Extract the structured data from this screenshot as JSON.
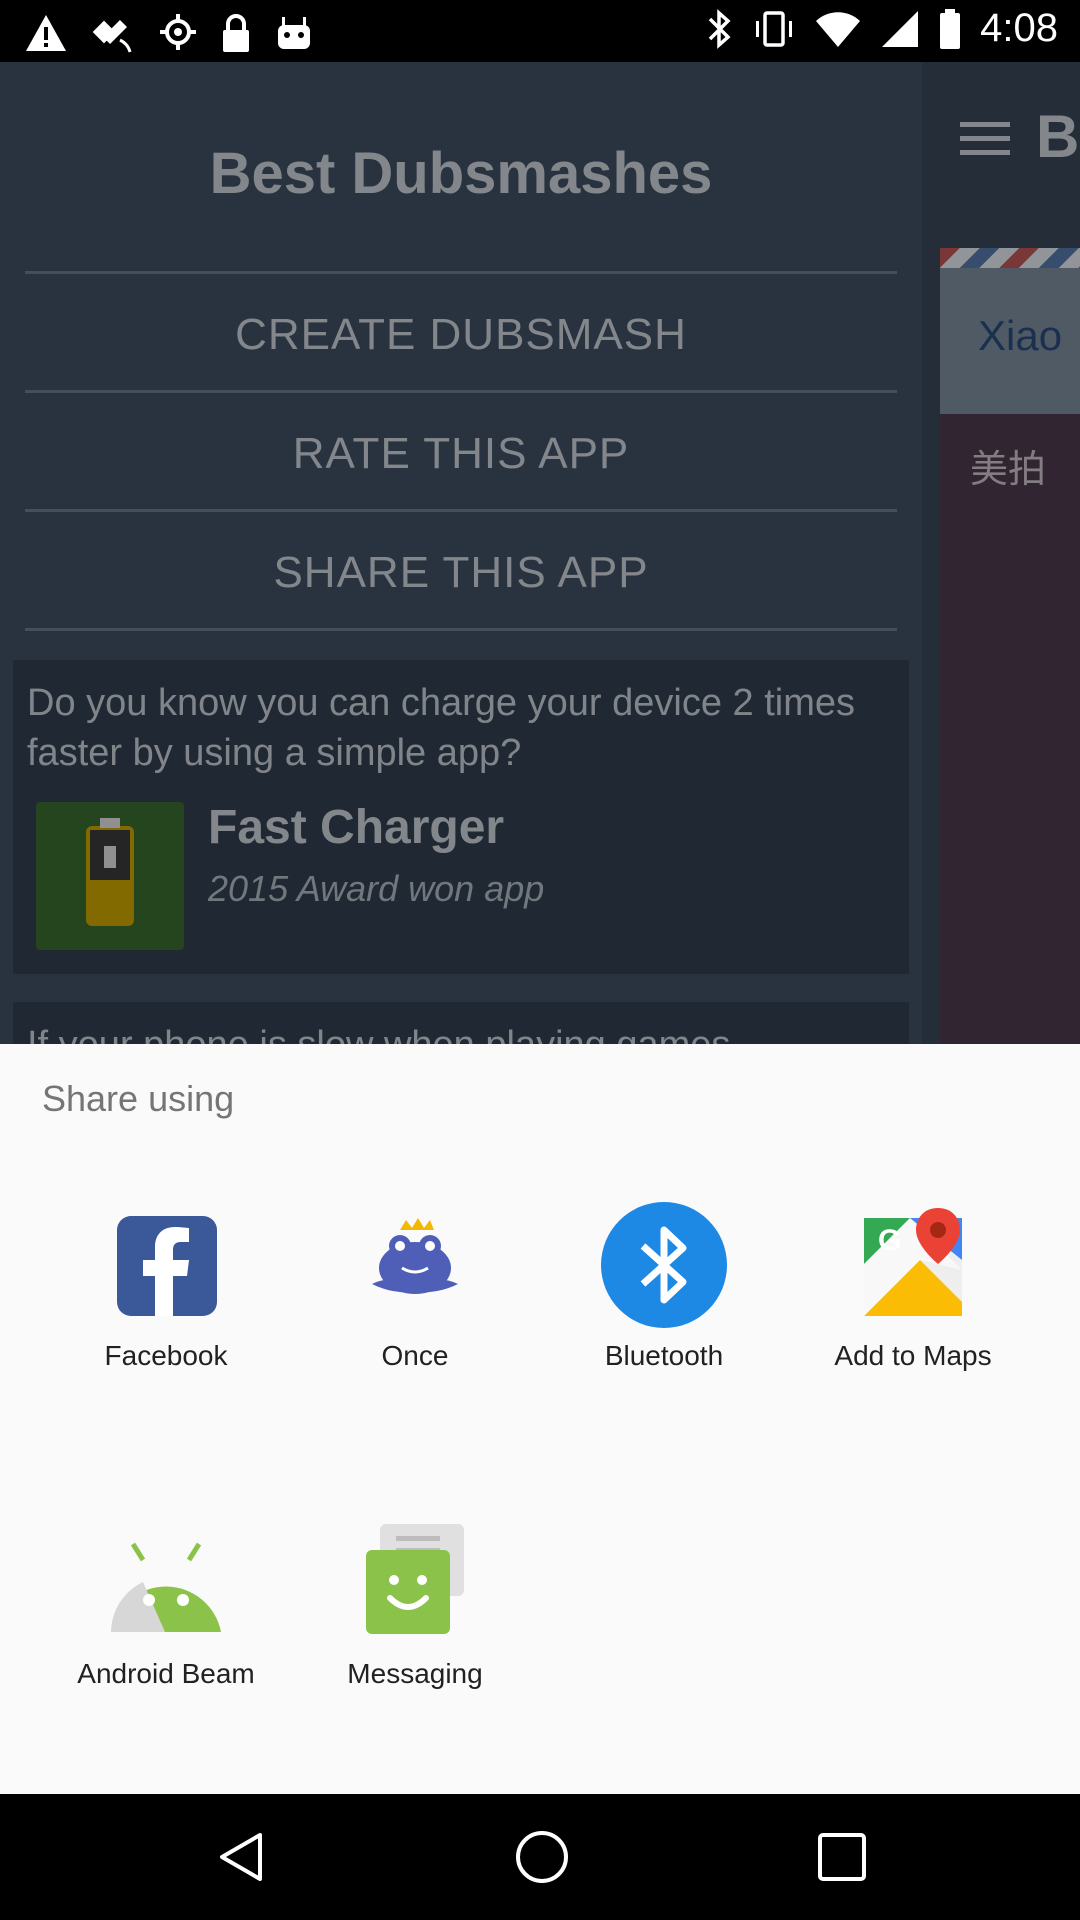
{
  "status_bar": {
    "time": "4:08",
    "left_icons": [
      "warning-icon",
      "fake-gps-icon",
      "location-off-icon",
      "lock-icon",
      "android-bot-icon"
    ],
    "right_icons": [
      "bluetooth-icon",
      "vibrate-icon",
      "wifi-icon",
      "signal-icon",
      "battery-icon"
    ]
  },
  "background_app": {
    "drawer_title": "Best Dubsmashes",
    "menu_items": [
      {
        "label": "CREATE DUBSMASH"
      },
      {
        "label": "RATE THIS APP"
      },
      {
        "label": "SHARE THIS APP"
      }
    ],
    "ad": {
      "text": "Do you know you can charge your device 2 times faster by using a simple app?",
      "app_name": "Fast Charger",
      "app_subtitle": "2015 Award won app"
    },
    "ad2_partial_text": "If your phone is slow when playing games",
    "right_panel": {
      "title_partial": "B",
      "text_partial": "Xiao",
      "text_partial_2": "美拍"
    }
  },
  "share_sheet": {
    "title": "Share using",
    "apps": [
      {
        "label": "Facebook",
        "icon": "facebook-icon"
      },
      {
        "label": "Once",
        "icon": "once-icon"
      },
      {
        "label": "Bluetooth",
        "icon": "bluetooth-icon"
      },
      {
        "label": "Add to Maps",
        "icon": "maps-icon"
      },
      {
        "label": "Android Beam",
        "icon": "android-beam-icon"
      },
      {
        "label": "Messaging",
        "icon": "messaging-icon"
      }
    ]
  },
  "nav_bar": {
    "buttons": [
      "back-icon",
      "home-icon",
      "recents-icon"
    ]
  },
  "colors": {
    "sheet_bg": "#fafafa",
    "facebook": "#3b5998",
    "bluetooth": "#1e88e5",
    "android": "#8bc34a",
    "messaging": "#8bc34a"
  }
}
